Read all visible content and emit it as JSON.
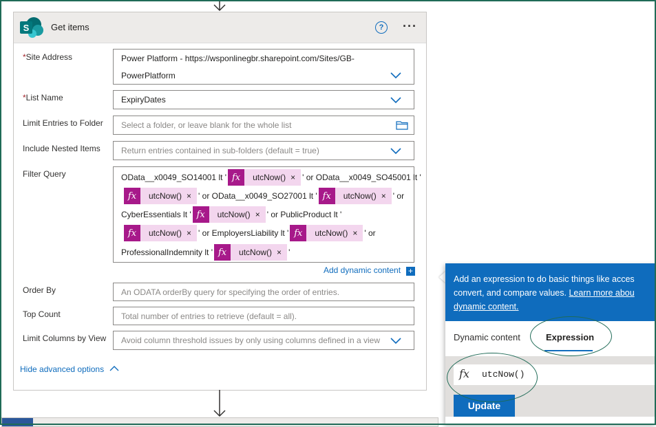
{
  "card": {
    "title": "Get items",
    "help_glyph": "?",
    "more_glyph": "···"
  },
  "fields": {
    "site_address": {
      "label": "Site Address",
      "required_mark": "*",
      "value_line1": "Power Platform - https://wsponlinegbr.sharepoint.com/Sites/GB-",
      "value_line2": "PowerPlatform"
    },
    "list_name": {
      "label": "List Name",
      "required_mark": "*",
      "value": "ExpiryDates"
    },
    "limit_folder": {
      "label": "Limit Entries to Folder",
      "placeholder": "Select a folder, or leave blank for the whole list"
    },
    "nested_items": {
      "label": "Include Nested Items",
      "placeholder": "Return entries contained in sub-folders (default = true)"
    },
    "filter_query": {
      "label": "Filter Query",
      "token_label": "utcNow()",
      "token_fx": "fx",
      "token_close": "×",
      "line1": [
        "OData__x0049_SO14001 lt '",
        "' or OData__x0049_SO45001 lt '"
      ],
      "line2": [
        "' or OData__x0049_SO27001 lt '",
        "' or"
      ],
      "line3": [
        "CyberEssentials lt '",
        "' or PublicProduct lt '"
      ],
      "line4": [
        "' or EmployersLiability lt '",
        "' or"
      ],
      "line5": [
        "ProfessionalIndemnity lt '",
        "'"
      ]
    },
    "add_dynamic": "Add dynamic content",
    "add_plus": "+",
    "order_by": {
      "label": "Order By",
      "placeholder": "An ODATA orderBy query for specifying the order of entries."
    },
    "top_count": {
      "label": "Top Count",
      "placeholder": "Total number of entries to retrieve (default = all)."
    },
    "limit_columns": {
      "label": "Limit Columns by View",
      "placeholder": "Avoid column threshold issues by only using columns defined in a view"
    },
    "hide_advanced": "Hide advanced options"
  },
  "panel": {
    "info_line1": "Add an expression to do basic things like acces",
    "info_line2_text": "convert, and compare values.",
    "info_line2_link": "Learn more abou",
    "info_line3_link": "dynamic content.",
    "tab_dynamic": "Dynamic content",
    "tab_expression": "Expression",
    "expr_fx": "fx",
    "expression": "utcNow()",
    "update_label": "Update"
  },
  "colors": {
    "accent": "#0f6cbd",
    "token_icon": "#a7198a",
    "token_bg": "#f3d6ee",
    "frame": "#1f6b57"
  }
}
